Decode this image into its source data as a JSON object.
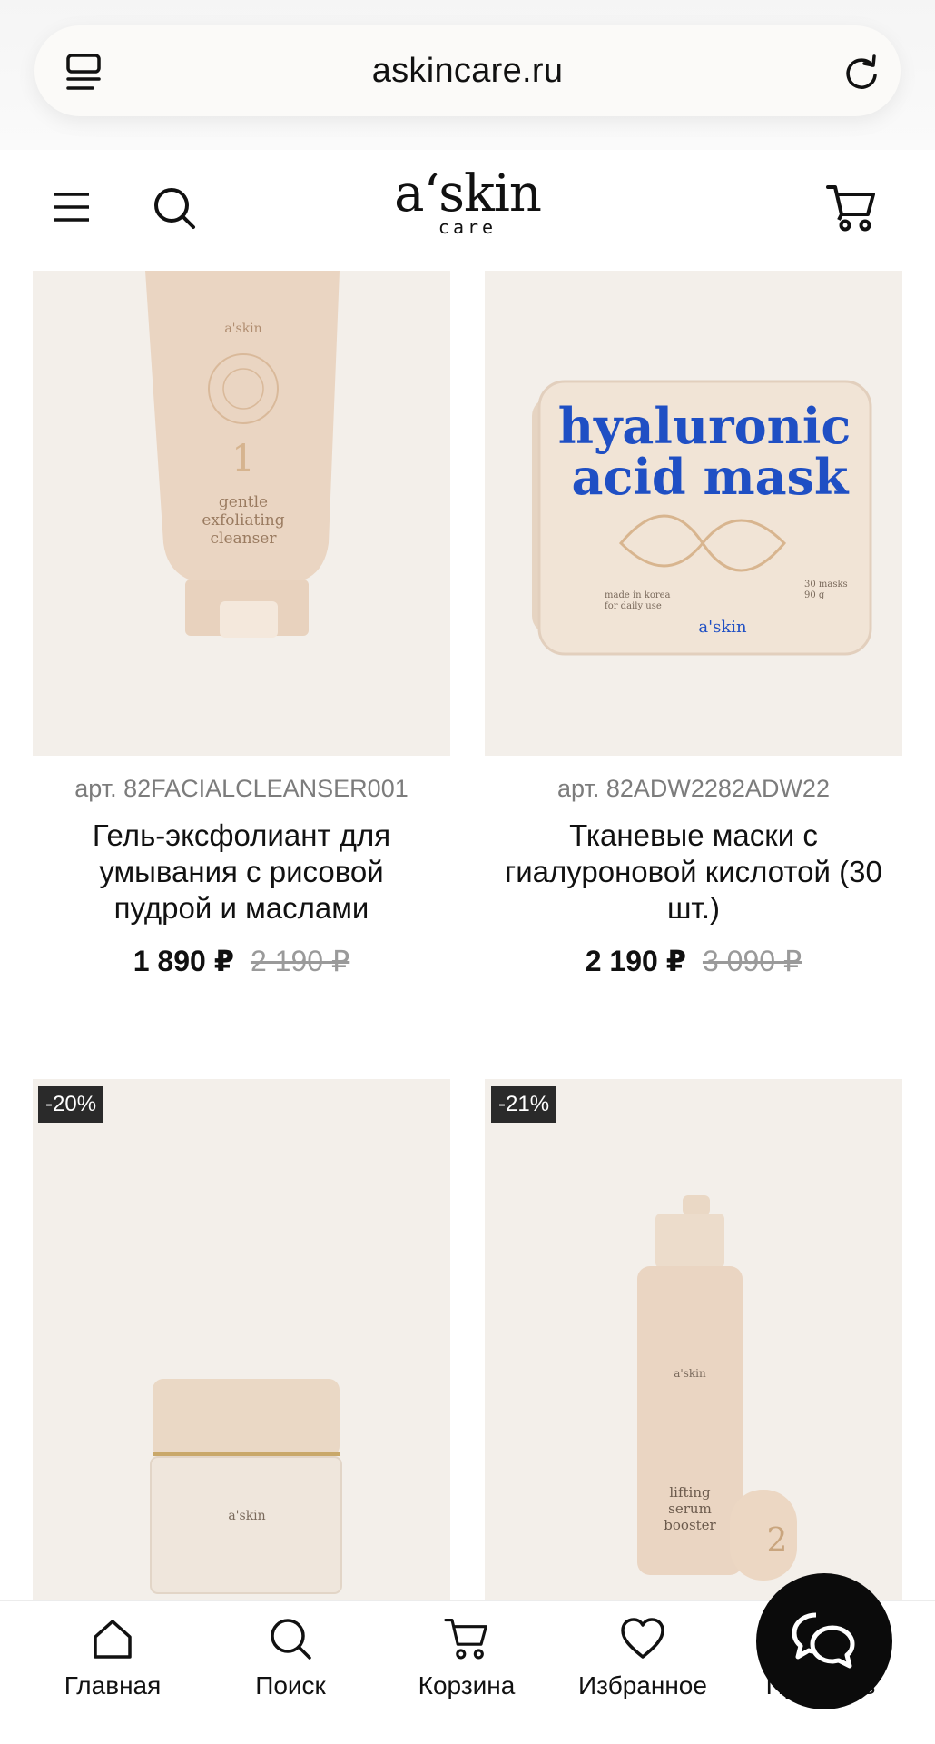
{
  "browser": {
    "url": "askincare.ru"
  },
  "header": {
    "logo_main": "a‘skin",
    "logo_sub": "care",
    "icons": [
      "menu-icon",
      "search-icon",
      "cart-icon"
    ]
  },
  "products": [
    {
      "article": "арт. 82FACIALCLEANSER001",
      "title": "Гель-эксфолиант для умывания с рисовой пудрой и маслами",
      "price": "1 890 ₽",
      "old_price": "2 190 ₽",
      "package_text": "gentle exfoliating cleanser",
      "package_number": "1"
    },
    {
      "article": "арт. 82ADW2282ADW22",
      "title": "Тканевые маски с гиалуроновой кислотой (30 шт.)",
      "price": "2 190 ₽",
      "old_price": "3 090 ₽",
      "package_line1": "hyaluronic",
      "package_line2": "acid mask",
      "package_small_left": "made in korea for daily use",
      "package_small_right": "30 masks 90 g"
    },
    {
      "badge": "-20%"
    },
    {
      "badge": "-21%",
      "package_text": "lifting serum booster",
      "package_number": "2"
    }
  ],
  "bottom_nav": {
    "items": [
      {
        "label": "Главная",
        "icon": "home-icon"
      },
      {
        "label": "Поиск",
        "icon": "search-icon"
      },
      {
        "label": "Корзина",
        "icon": "cart-icon"
      },
      {
        "label": "Избранное",
        "icon": "heart-icon"
      },
      {
        "label": "Профиль",
        "icon": "profile-icon"
      }
    ],
    "chat_icon": "chat-icon"
  },
  "colors": {
    "card_bg": "#f3efea",
    "product_beige": "#ecd9c6",
    "mask_blue": "#1f4fc4",
    "badge_bg": "#2a2a2a"
  }
}
